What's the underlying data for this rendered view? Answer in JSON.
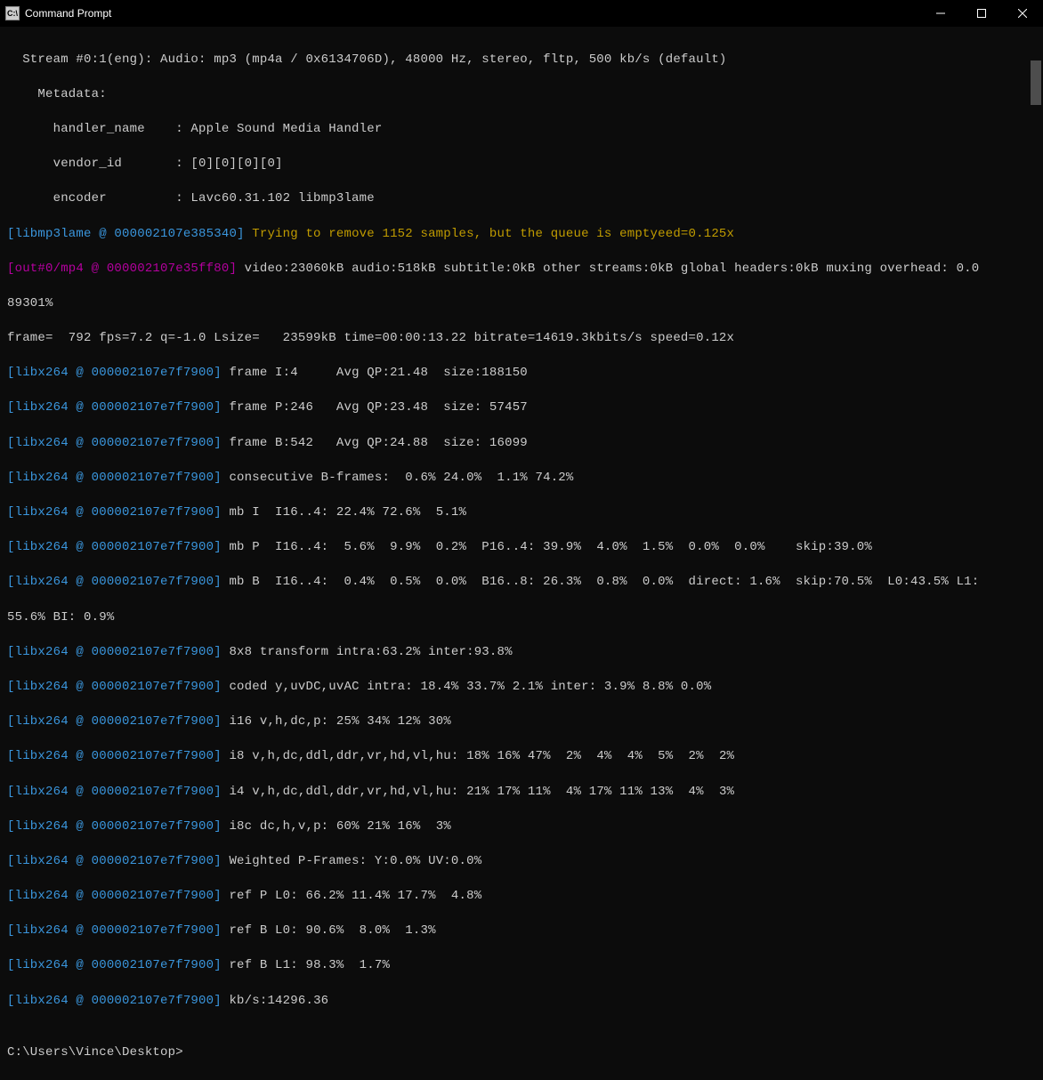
{
  "window": {
    "title": "Command Prompt",
    "icon_label": "C:\\"
  },
  "lines": {
    "l0": "  Stream #0:1(eng): Audio: mp3 (mp4a / 0x6134706D), 48000 Hz, stereo, fltp, 500 kb/s (default)",
    "l1": "    Metadata:",
    "l2": "      handler_name    : Apple Sound Media Handler",
    "l3": "      vendor_id       : [0][0][0][0]",
    "l4": "      encoder         : Lavc60.31.102 libmp3lame",
    "l5p": "[libmp3lame @ 000002107e385340] ",
    "l5s": "Trying to remove 1152 samples, but the queue is emptyeed=0.125x",
    "l6p": "[out#0/mp4 @ 000002107e35ff80] ",
    "l6s": "video:23060kB audio:518kB subtitle:0kB other streams:0kB global headers:0kB muxing overhead: 0.0",
    "l7": "89301%",
    "l8": "frame=  792 fps=7.2 q=-1.0 Lsize=   23599kB time=00:00:13.22 bitrate=14619.3kbits/s speed=0.12x",
    "lx_prefix": "[libx264 @ 000002107e7f7900] ",
    "lx": [
      "frame I:4     Avg QP:21.48  size:188150",
      "frame P:246   Avg QP:23.48  size: 57457",
      "frame B:542   Avg QP:24.88  size: 16099",
      "consecutive B-frames:  0.6% 24.0%  1.1% 74.2%",
      "mb I  I16..4: 22.4% 72.6%  5.1%",
      "mb P  I16..4:  5.6%  9.9%  0.2%  P16..4: 39.9%  4.0%  1.5%  0.0%  0.0%    skip:39.0%",
      "mb B  I16..4:  0.4%  0.5%  0.0%  B16..8: 26.3%  0.8%  0.0%  direct: 1.6%  skip:70.5%  L0:43.5% L1:"
    ],
    "wrap_tail": "55.6% BI: 0.9%",
    "lx2": [
      "8x8 transform intra:63.2% inter:93.8%",
      "coded y,uvDC,uvAC intra: 18.4% 33.7% 2.1% inter: 3.9% 8.8% 0.0%",
      "i16 v,h,dc,p: 25% 34% 12% 30%",
      "i8 v,h,dc,ddl,ddr,vr,hd,vl,hu: 18% 16% 47%  2%  4%  4%  5%  2%  2%",
      "i4 v,h,dc,ddl,ddr,vr,hd,vl,hu: 21% 17% 11%  4% 17% 11% 13%  4%  3%",
      "i8c dc,h,v,p: 60% 21% 16%  3%",
      "Weighted P-Frames: Y:0.0% UV:0.0%",
      "ref P L0: 66.2% 11.4% 17.7%  4.8%",
      "ref B L0: 90.6%  8.0%  1.3%",
      "ref B L1: 98.3%  1.7%",
      "kb/s:14296.36"
    ],
    "blank": "",
    "prompt": "C:\\Users\\Vince\\Desktop>"
  }
}
